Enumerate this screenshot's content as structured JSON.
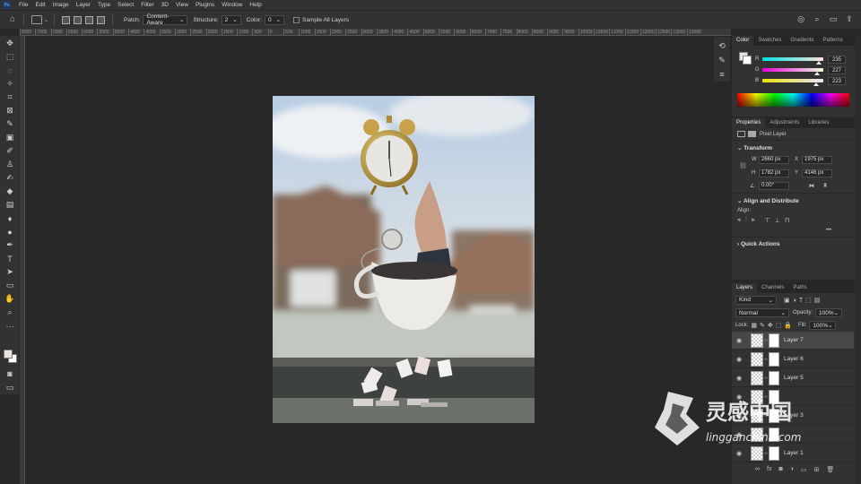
{
  "menu": {
    "logo": "Ps",
    "items": [
      "File",
      "Edit",
      "Image",
      "Layer",
      "Type",
      "Select",
      "Filter",
      "3D",
      "View",
      "Plugins",
      "Window",
      "Help"
    ]
  },
  "options": {
    "patch_label": "Patch:",
    "patch_value": "Content-Aware",
    "structure_label": "Structure:",
    "structure_value": "2",
    "color_label": "Color:",
    "color_value": "0",
    "sample_all_layers": "Sample All Layers"
  },
  "ruler": {
    "ticks": [
      "8000",
      "7500",
      "7000",
      "6500",
      "6000",
      "5500",
      "5000",
      "4500",
      "4000",
      "3500",
      "3000",
      "2500",
      "2000",
      "1500",
      "1000",
      "500",
      "0",
      "500",
      "1000",
      "1500",
      "2000",
      "2500",
      "3000",
      "3500",
      "4000",
      "4500",
      "5000",
      "5500",
      "6000",
      "6500",
      "7000",
      "7500",
      "8000",
      "8500",
      "9000",
      "9500",
      "10000",
      "10500",
      "11000",
      "11500",
      "12000",
      "12500",
      "13000",
      "13500"
    ]
  },
  "color_panel": {
    "tabs": [
      "Color",
      "Swatches",
      "Gradients",
      "Patterns"
    ],
    "r_label": "R",
    "r_value": "235",
    "g_label": "G",
    "g_value": "227",
    "b_label": "B",
    "b_value": "223",
    "foreground": "#ebe3df",
    "background": "#ffffff"
  },
  "properties": {
    "tabs": [
      "Properties",
      "Adjustments",
      "Libraries"
    ],
    "layer_type": "Pixel Layer",
    "transform_title": "Transform",
    "w_label": "W",
    "w_value": "2660 px",
    "h_label": "H",
    "h_value": "1782 px",
    "x_label": "X",
    "x_value": "1975 px",
    "y_label": "Y",
    "y_value": "4146 px",
    "angle_value": "0.00°",
    "align_title": "Align and Distribute",
    "align_label": "Align:",
    "more": "•••",
    "quick_actions": "Quick Actions"
  },
  "layers_panel": {
    "tabs": [
      "Layers",
      "Channels",
      "Paths"
    ],
    "kind": "Kind",
    "blend_mode": "Normal",
    "opacity_label": "Opacity:",
    "opacity_value": "100%",
    "lock_label": "Lock:",
    "fill_label": "Fill:",
    "fill_value": "100%",
    "layers": [
      {
        "name": "Layer 7",
        "selected": true
      },
      {
        "name": "Layer 6",
        "selected": false
      },
      {
        "name": "Layer 5",
        "selected": false
      },
      {
        "name": "",
        "selected": false
      },
      {
        "name": "Layer 3",
        "selected": false
      },
      {
        "name": "",
        "selected": false
      },
      {
        "name": "Layer 1",
        "selected": false
      }
    ]
  },
  "watermark": {
    "text": "灵感中国",
    "url": "lingganchina.com"
  }
}
